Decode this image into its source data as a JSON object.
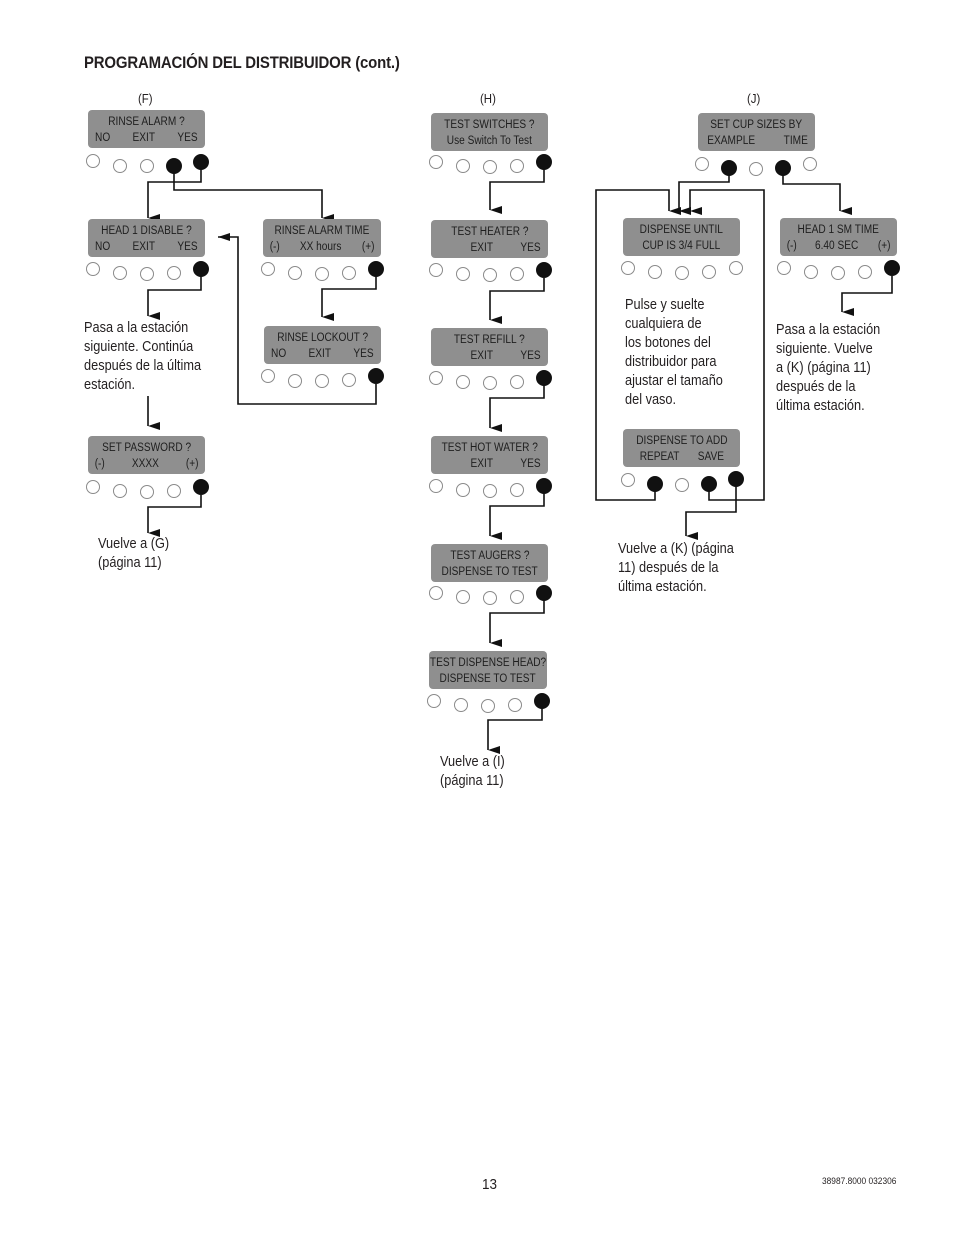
{
  "page": {
    "title": "PROGRAMACIÓN DEL DISTRIBUIDOR (cont.)",
    "page_number": "13",
    "doc_number": "38987.8000 032306"
  },
  "sections": {
    "F": {
      "label": "(F)",
      "rinse_alarm": {
        "line1": [
          "RINSE  ALARM  ?"
        ],
        "line2": [
          "NO",
          "EXIT",
          "YES"
        ],
        "buttons_active": [
          4,
          5
        ]
      },
      "head1_disable": {
        "line1": [
          "HEAD  1  DISABLE  ?"
        ],
        "line2": [
          "NO",
          "EXIT",
          "YES"
        ],
        "buttons_active": [
          5
        ]
      },
      "rinse_alarm_time": {
        "line1": [
          "RINSE  ALARM  TIME"
        ],
        "line2": [
          "(-)",
          "XX hours",
          "(+)"
        ],
        "buttons_active": [
          5
        ]
      },
      "rinse_lockout": {
        "line1": [
          "RINSE  LOCKOUT  ?"
        ],
        "line2": [
          "NO",
          "EXIT",
          "YES"
        ],
        "buttons_active": [
          5
        ]
      },
      "set_password": {
        "line1": [
          "SET  PASSWORD  ?"
        ],
        "line2": [
          "(-)",
          "XXXX",
          "(+)"
        ],
        "buttons_active": [
          5
        ]
      },
      "note_next_station": "Pasa a la estación\nsiguiente. Continúa\ndespués de la última\nestación.",
      "note_return": "Vuelve a (G)\n(página 11)"
    },
    "H": {
      "label": "(H)",
      "test_switches": {
        "line1": [
          "TEST  SWITCHES  ?"
        ],
        "line2": [
          "Use Switch To Test"
        ],
        "buttons_active": [
          5
        ]
      },
      "test_heater": {
        "line1": [
          "TEST  HEATER  ?"
        ],
        "line2": [
          "EXIT",
          "YES"
        ],
        "buttons_active": [
          5
        ]
      },
      "test_refill": {
        "line1": [
          "TEST  REFILL  ?"
        ],
        "line2": [
          "EXIT",
          "YES"
        ],
        "buttons_active": [
          5
        ]
      },
      "test_hot_water": {
        "line1": [
          "TEST  HOT  WATER  ?"
        ],
        "line2": [
          "EXIT",
          "YES"
        ],
        "buttons_active": [
          5
        ]
      },
      "test_augers": {
        "line1": [
          "TEST  AUGERS  ?"
        ],
        "line2": [
          "DISPENSE TO TEST"
        ],
        "buttons_active": [
          5
        ]
      },
      "test_dispense_head": {
        "line1": [
          "TEST DISPENSE HEAD?"
        ],
        "line2": [
          "DISPENSE TO TEST"
        ],
        "buttons_active": [
          5
        ]
      },
      "note_return": "Vuelve a (I)\n(página 11)"
    },
    "J": {
      "label": "(J)",
      "set_cup_sizes": {
        "line1": [
          "SET  CUP  SIZES  BY"
        ],
        "line2": [
          "EXAMPLE",
          "TIME"
        ],
        "buttons_active": [
          2,
          4
        ]
      },
      "dispense_until": {
        "line1": [
          "DISPENSE  UNTIL"
        ],
        "line2": [
          "CUP  IS  3/4  FULL"
        ],
        "buttons_active": []
      },
      "head1_sm_time": {
        "line1": [
          "HEAD  1  SM  TIME"
        ],
        "line2": [
          "(-)",
          "6.40  SEC",
          "(+)"
        ],
        "buttons_active": [
          5
        ]
      },
      "dispense_to_add": {
        "line1": [
          "DISPENSE  TO  ADD"
        ],
        "line2": [
          "REPEAT",
          "SAVE"
        ],
        "buttons_active": [
          2,
          4,
          5
        ]
      },
      "note_adjust": "Pulse y suelte\ncualquiera de\nlos botones del\ndistribuidor para\najustar el tamaño\ndel vaso.",
      "note_next_station": "Pasa a la estación\nsiguiente. Vuelve\na (K) (página 11)\ndespués de la\núltima estación.",
      "note_return": "Vuelve a (K) (página\n11) después de la\núltima estación."
    }
  }
}
